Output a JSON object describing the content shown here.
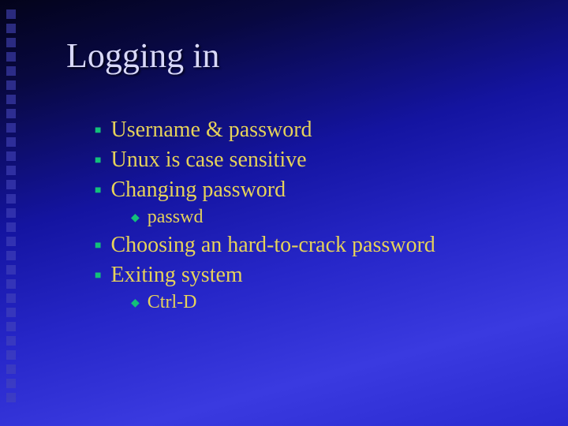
{
  "title": "Logging in",
  "bullets": [
    {
      "level": 1,
      "text": "Username & password"
    },
    {
      "level": 1,
      "text": "Unux is case sensitive"
    },
    {
      "level": 1,
      "text": "Changing password"
    },
    {
      "level": 2,
      "text": " passwd"
    },
    {
      "level": 1,
      "text": "Choosing an hard-to-crack password"
    },
    {
      "level": 1,
      "text": "Exiting system"
    },
    {
      "level": 2,
      "text": "Ctrl-D"
    }
  ]
}
